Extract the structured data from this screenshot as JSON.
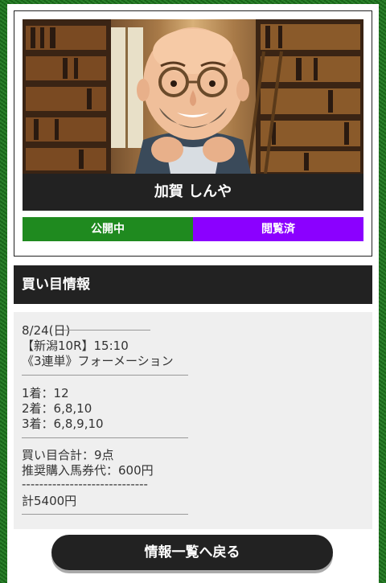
{
  "profile": {
    "name": "加賀 しんや",
    "status_public": "公開中",
    "status_viewed": "閲覧済"
  },
  "section_title": "買い目情報",
  "info": {
    "date": "8/24(日)",
    "race": "【新潟10R】15:10",
    "bet_type": "《3連単》フォーメーション",
    "first": "1着：12",
    "second": "2着：6,8,10",
    "third": "3着：6,8,9,10",
    "total_points": "買い目合計：9点",
    "recommended": "推奨購入馬券代：600円",
    "dashes": "-----------------------------",
    "total": "計5400円"
  },
  "back_button_label": "情報一覧へ戻る",
  "colors": {
    "public": "#1f8a1f",
    "viewed": "#8b00ff",
    "dark": "#222222"
  }
}
